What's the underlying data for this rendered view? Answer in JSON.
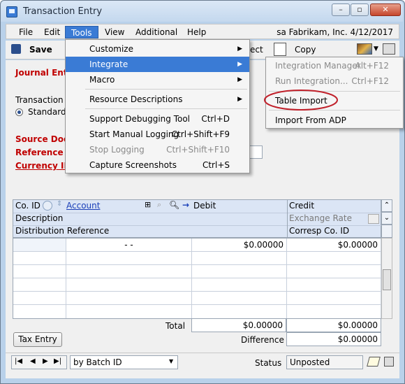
{
  "window": {
    "title": "Transaction Entry",
    "min": "–",
    "max": "▫",
    "close": "✕"
  },
  "menubar": {
    "items": [
      "File",
      "Edit",
      "Tools",
      "View",
      "Additional",
      "Help"
    ],
    "company": "sa  Fabrikam, Inc.  4/12/2017"
  },
  "toolbar": {
    "save": "Save",
    "correct": "ect",
    "copy": "Copy"
  },
  "form": {
    "journal_entry": "Journal Entr",
    "transaction_type": "Transaction Ty",
    "standard": "Standard",
    "source_doc": "Source Docu",
    "reference": "Reference",
    "currency_id": "Currency ID"
  },
  "tools_menu": {
    "items": [
      {
        "label": "Customize",
        "shortcut": "",
        "submenu": true
      },
      {
        "label": "Integrate",
        "shortcut": "",
        "submenu": true
      },
      {
        "label": "Macro",
        "shortcut": "",
        "submenu": true
      },
      {
        "label": "Resource Descriptions",
        "shortcut": "",
        "submenu": true
      },
      {
        "label": "Support Debugging Tool",
        "shortcut": "Ctrl+D"
      },
      {
        "label": "Start Manual Logging",
        "shortcut": "Ctrl+Shift+F9"
      },
      {
        "label": "Stop Logging",
        "shortcut": "Ctrl+Shift+F10"
      },
      {
        "label": "Capture Screenshots",
        "shortcut": "Ctrl+S"
      }
    ]
  },
  "integrate_menu": {
    "items": [
      {
        "label": "Integration Manager",
        "shortcut": "Alt+F12"
      },
      {
        "label": "Run Integration...",
        "shortcut": "Ctrl+F12"
      },
      {
        "label": "Table Import",
        "shortcut": ""
      },
      {
        "label": "Import From ADP",
        "shortcut": ""
      }
    ]
  },
  "grid": {
    "headers": {
      "co_id": "Co. ID",
      "account": "Account",
      "debit": "Debit",
      "credit": "Credit",
      "description": "Description",
      "exchange_rate": "Exchange Rate",
      "dist_ref": "Distribution Reference",
      "corresp": "Corresp Co. ID"
    },
    "row1": {
      "account": "-        -",
      "debit": "$0.00000",
      "credit": "$0.00000"
    },
    "total_label": "Total",
    "total_debit": "$0.00000",
    "total_credit": "$0.00000",
    "difference_label": "Difference",
    "difference_credit": "$0.00000"
  },
  "footer": {
    "tax_entry": "Tax Entry",
    "sort": "by Batch ID",
    "status_label": "Status",
    "status_value": "Unposted"
  },
  "colors": {
    "accent": "#3a7bd5",
    "required_label": "#c00000",
    "highlight_circle": "#c0202a"
  }
}
